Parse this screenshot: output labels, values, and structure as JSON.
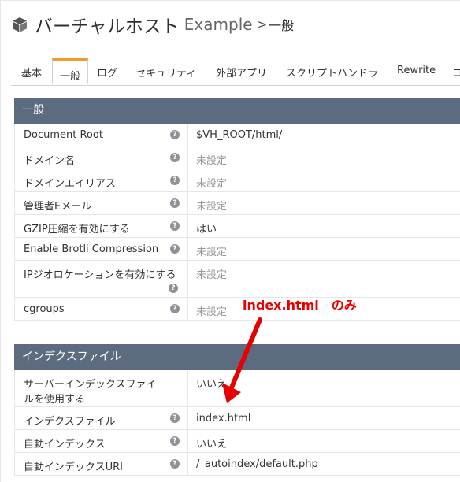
{
  "header": {
    "title": "バーチャルホスト",
    "vhost_name": "Example",
    "separator": ">",
    "section": "一般"
  },
  "tabs": [
    {
      "label": "基本",
      "active": false
    },
    {
      "label": "一般",
      "active": true
    },
    {
      "label": "ログ",
      "active": false
    },
    {
      "label": "セキュリティ",
      "active": false
    },
    {
      "label": "外部アプリ",
      "active": false
    },
    {
      "label": "スクリプトハンドラ",
      "active": false
    },
    {
      "label": "Rewrite",
      "active": false
    },
    {
      "label": "コ",
      "active": false
    }
  ],
  "general": {
    "heading": "一般",
    "rows": [
      {
        "label": "Document Root",
        "value": "$VH_ROOT/html/"
      },
      {
        "label": "ドメイン名",
        "value": "未設定"
      },
      {
        "label": "ドメインエイリアス",
        "value": "未設定"
      },
      {
        "label": "管理者Eメール",
        "value": "未設定"
      },
      {
        "label": "GZIP圧縮を有効にする",
        "value": "はい"
      },
      {
        "label": "Enable Brotli Compression",
        "value": "未設定"
      },
      {
        "label": "IPジオロケーションを有効にする",
        "value": "未設定"
      },
      {
        "label": "cgroups",
        "value": "未設定"
      }
    ]
  },
  "index": {
    "heading": "インデクスファイル",
    "rows": [
      {
        "label": "サーバーインデックスファイルを使用する",
        "value": "いいえ"
      },
      {
        "label": "インデクスファイル",
        "value": "index.html"
      },
      {
        "label": "自動インデックス",
        "value": "いいえ"
      },
      {
        "label": "自動インデックスURI",
        "value": "/_autoindex/default.php"
      }
    ]
  },
  "annotation": {
    "text": "index.html　のみ",
    "color": "#e60000"
  },
  "colors": {
    "section_header_bg": "#5c6b80",
    "active_tab_accent": "#f29a2e",
    "unset_text": "#999999"
  },
  "icons": {
    "header_icon": "box-icon",
    "help_icon": "help-icon"
  }
}
